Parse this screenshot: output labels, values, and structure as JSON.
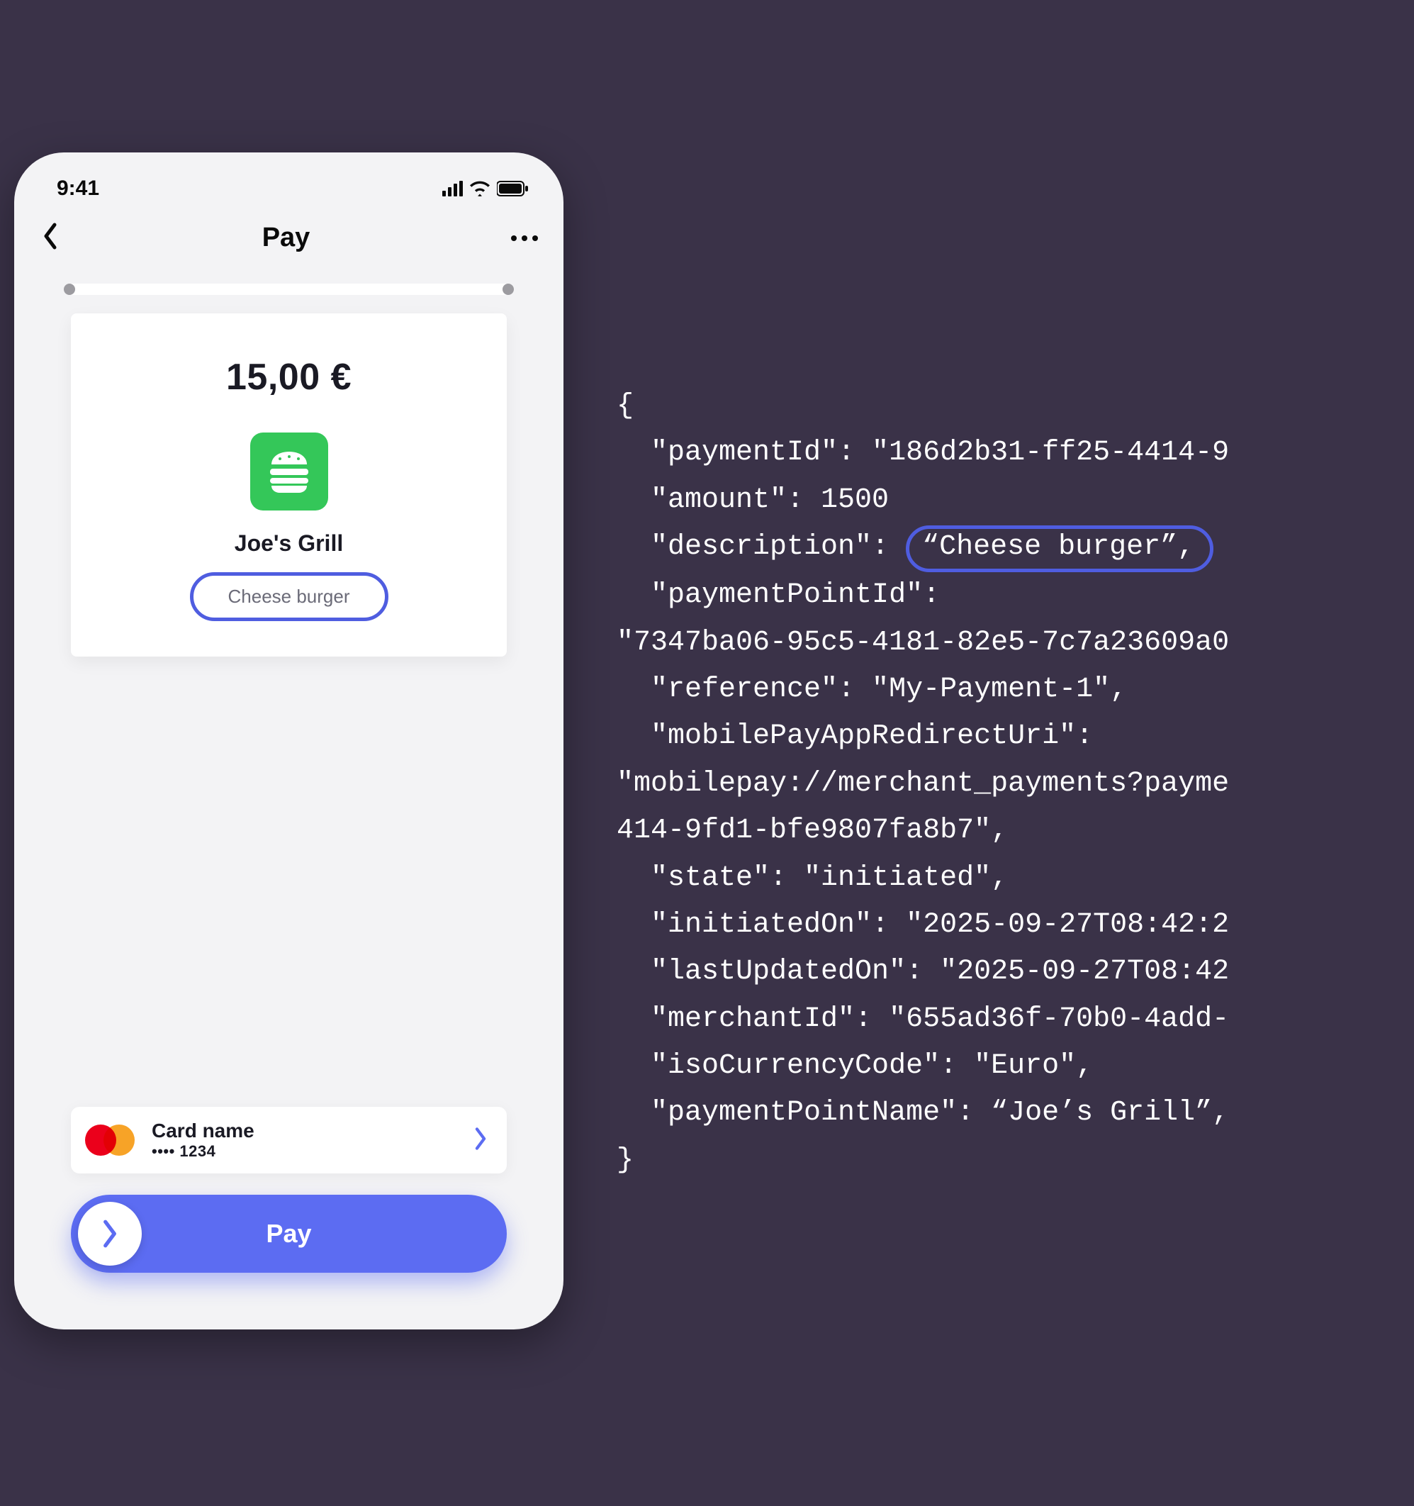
{
  "phone": {
    "status": {
      "time": "9:41"
    },
    "nav": {
      "title": "Pay"
    },
    "receipt": {
      "amount": "15,00 €",
      "merchant": "Joe's Grill",
      "description": "Cheese burger"
    },
    "card": {
      "name": "Card name",
      "masked": "•••• 1234"
    },
    "paySlider": {
      "label": "Pay"
    }
  },
  "code": {
    "open": "{",
    "l1_pre": "  \"paymentId\": \"186d2b31-ff25-4414-9",
    "l2": "  \"amount\": 1500",
    "l3_key": "  \"description\": ",
    "l3_val": "“Cheese burger”,",
    "l4": "  \"paymentPointId\":",
    "l5": "\"7347ba06-95c5-4181-82e5-7c7a23609a0",
    "l6": "  \"reference\": \"My-Payment-1\",",
    "l7": "  \"mobilePayAppRedirectUri\":",
    "l8": "\"mobilepay://merchant_payments?payme",
    "l9": "414-9fd1-bfe9807fa8b7\",",
    "l10": "  \"state\": \"initiated\",",
    "l11": "  \"initiatedOn\": \"2025-09-27T08:42:2",
    "l12": "  \"lastUpdatedOn\": \"2025-09-27T08:42",
    "l13": "  \"merchantId\": \"655ad36f-70b0-4add-",
    "l14": "  \"isoCurrencyCode\": \"Euro\",",
    "l15": "  \"paymentPointName\": “Joe’s Grill”,",
    "close": "}"
  }
}
